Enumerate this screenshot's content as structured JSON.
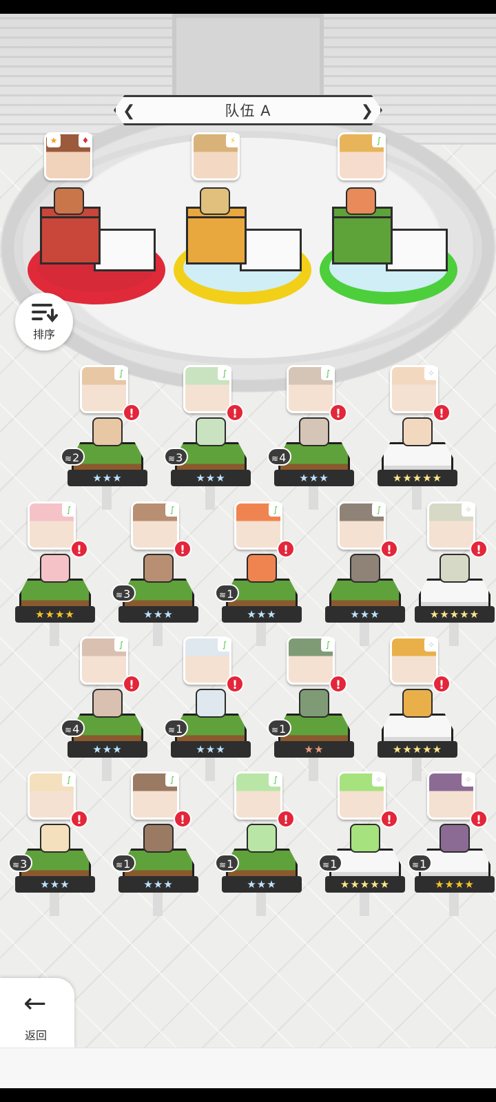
{
  "team": {
    "name": "队伍 A"
  },
  "sort_button": {
    "label": "排序"
  },
  "back_button": {
    "label": "返回"
  },
  "team_slots": [
    {
      "element": "fire",
      "element_color": "#d9323a",
      "pad_color": "#e02a39",
      "block_color": "#c9473a"
    },
    {
      "element": "light",
      "element_color": "#f2c21b",
      "pad_color": "#f2d019",
      "block_color": "#e9a83e"
    },
    {
      "element": "wind",
      "element_color": "#48c23a",
      "pad_color": "#4ccf3b",
      "block_color": "#5ea33a"
    }
  ],
  "roster": [
    {
      "element": "wind",
      "stars": "★★★",
      "star_tier": "normal",
      "dup": "2"
    },
    {
      "element": "wind",
      "stars": "★★★",
      "star_tier": "normal",
      "dup": "3"
    },
    {
      "element": "wind",
      "stars": "★★★",
      "star_tier": "normal",
      "dup": "4"
    },
    {
      "element": "light",
      "stars": "★★★★★",
      "star_tier": "rainbow",
      "dup": ""
    },
    {
      "element": "wind",
      "stars": "★★★★",
      "star_tier": "gold",
      "dup": ""
    },
    {
      "element": "wind",
      "stars": "★★★",
      "star_tier": "normal",
      "dup": "3"
    },
    {
      "element": "wind",
      "stars": "★★★",
      "star_tier": "normal",
      "dup": "1"
    },
    {
      "element": "wind",
      "stars": "★★★",
      "star_tier": "normal",
      "dup": ""
    },
    {
      "element": "light",
      "stars": "★★★★★",
      "star_tier": "rainbow",
      "dup": ""
    },
    {
      "element": "wind",
      "stars": "★★★",
      "star_tier": "normal",
      "dup": "4"
    },
    {
      "element": "wind",
      "stars": "★★★",
      "star_tier": "normal",
      "dup": "1"
    },
    {
      "element": "wind",
      "stars": "★★",
      "star_tier": "bronze",
      "dup": "1"
    },
    {
      "element": "light",
      "stars": "★★★★★",
      "star_tier": "rainbow",
      "dup": ""
    },
    {
      "element": "wind",
      "stars": "★★★",
      "star_tier": "normal",
      "dup": "3"
    },
    {
      "element": "wind",
      "stars": "★★★",
      "star_tier": "normal",
      "dup": "1"
    },
    {
      "element": "wind",
      "stars": "★★★",
      "star_tier": "normal",
      "dup": "1"
    },
    {
      "element": "light",
      "stars": "★★★★★",
      "star_tier": "rainbow",
      "dup": "1"
    },
    {
      "element": "light",
      "stars": "★★★★",
      "star_tier": "gold",
      "dup": "1"
    }
  ],
  "alert_glyph": "!",
  "colors": {
    "alert": "#e3263a",
    "wind_platform": "#5c9f3a",
    "light_platform": "#f2f2f2"
  }
}
